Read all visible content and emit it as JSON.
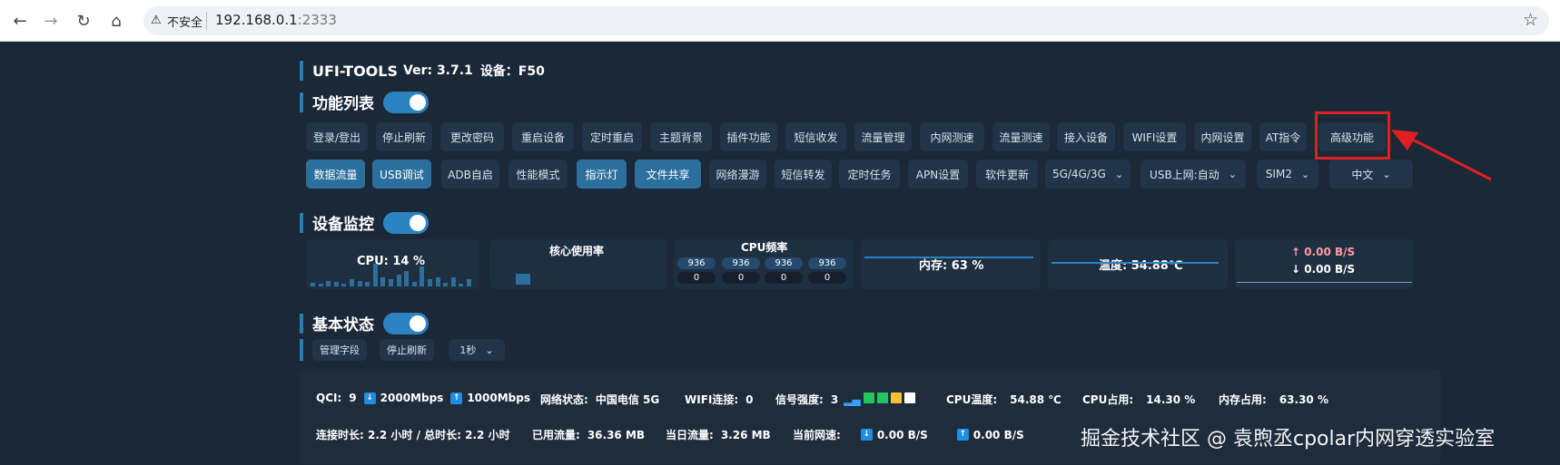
{
  "browser": {
    "security_label": "不安全",
    "url_host": "192.168.0.1",
    "url_port": ":2333"
  },
  "header": {
    "app_title": "UFI-TOOLS",
    "version_label": "Ver: 3.7.1",
    "device_label": "设备：F50"
  },
  "function_list": {
    "title": "功能列表",
    "row1": [
      "登录/登出",
      "停止刷新",
      "更改密码",
      "重启设备",
      "定时重启",
      "主题背景",
      "插件功能",
      "短信收发",
      "流量管理",
      "内网测速",
      "流量测速",
      "接入设备",
      "WIFI设置",
      "内网设置",
      "AT指令",
      "高级功能"
    ],
    "row2": [
      "数据流量",
      "USB调试",
      "ADB自启",
      "性能模式",
      "指示灯",
      "文件共享",
      "网络漫游",
      "短信转发",
      "定时任务",
      "APN设置",
      "软件更新"
    ],
    "selects": [
      "5G/4G/3G",
      "USB上网:自动",
      "SIM2",
      "中文"
    ]
  },
  "monitor": {
    "title": "设备监控",
    "cpu_label": "CPU: 14 %",
    "core_usage_label": "核心使用率",
    "cpu_freq_label": "CPU频率",
    "freq_values": [
      "936",
      "936",
      "936",
      "936"
    ],
    "freq_usage": [
      "0",
      "0",
      "0",
      "0"
    ],
    "memory_label": "内存: 63 %",
    "temp_label": "温度: 54.88℃",
    "upload_label": "↑ 0.00 B/S",
    "download_label": "↓ 0.00 B/S",
    "cpu_history": [
      0.15,
      0.1,
      0.25,
      0.2,
      0.1,
      0.3,
      0.25,
      0.2,
      0.95,
      0.4,
      0.3,
      0.5,
      0.65,
      0.2,
      0.85,
      0.3,
      0.4,
      0.15,
      0.4,
      0.1,
      0.3
    ],
    "core_usage": [
      0.4
    ],
    "memory_usage": 0.63,
    "temp_level": 0.55
  },
  "basic": {
    "title": "基本状态",
    "manage_fields": "管理字段",
    "stop_refresh": "停止刷新",
    "interval": "1秒"
  },
  "status": {
    "qci_key": "QCI:",
    "qci_val": "9",
    "down_speed": "2000Mbps",
    "up_speed": "1000Mbps",
    "network_key": "网络状态:",
    "network_val": "中国电信 5G",
    "wifi_key": "WIFI连接:",
    "wifi_val": "0",
    "signal_key": "信号强度:",
    "signal_val": "3",
    "cpu_temp_key": "CPU温度:",
    "cpu_temp_val": "54.88 ℃",
    "cpu_use_key": "CPU占用:",
    "cpu_use_val": "14.30 %",
    "mem_use_key": "内存占用:",
    "mem_use_val": "63.30 %",
    "connect_time": "连接时长: 2.2 小时 / 总时长: 2.2 小时",
    "used_key": "已用流量:",
    "used_val": "36.36 MB",
    "today_key": "当日流量:",
    "today_val": "3.26 MB",
    "cur_speed_key": "当前网速:",
    "cur_down": "0.00 B/S",
    "cur_up": "0.00 B/S"
  },
  "watermark": "掘金技术社区 @ 袁煦丞cpolar内网穿透实验室",
  "colors": {
    "background": "#1a2838",
    "button": "#223448",
    "active_button": "#2b6f9c",
    "accent": "#2d83c0",
    "highlight": "#e02020",
    "upload": "#ff9aa6"
  },
  "signal_colors": [
    "#22c55e",
    "#22c55e",
    "#f4c430",
    "#ffffff"
  ]
}
